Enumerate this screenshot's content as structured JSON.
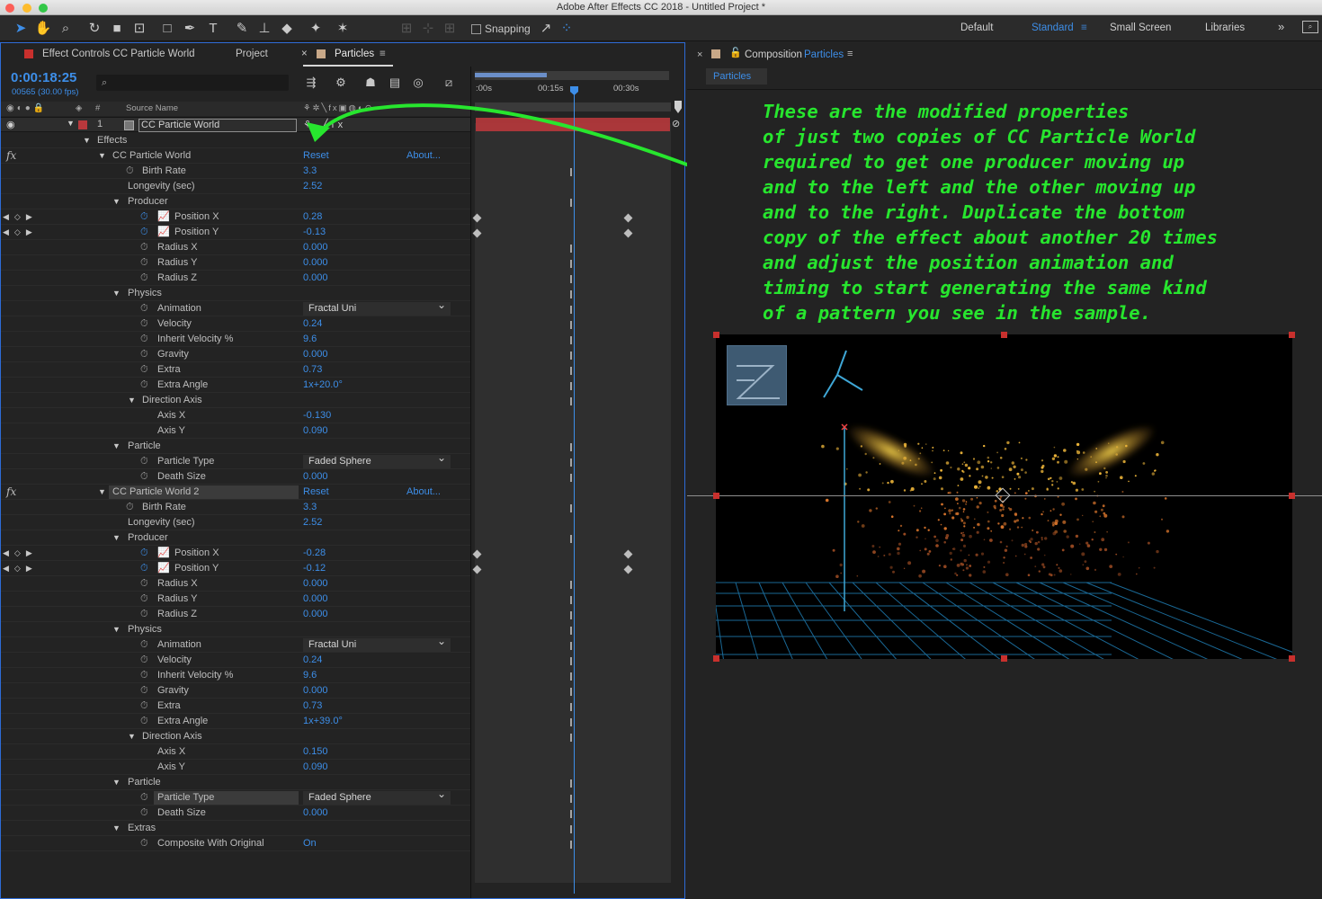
{
  "window": {
    "title": "Adobe After Effects CC 2018 - Untitled Project *"
  },
  "toolbar": {
    "snapping": "Snapping",
    "workspaces": [
      "Default",
      "Standard",
      "Small Screen",
      "Libraries"
    ],
    "active_workspace": "Standard",
    "more": "»"
  },
  "left_tabs": {
    "effect_controls": "Effect Controls CC Particle World",
    "project": "Project",
    "particles": "Particles",
    "close": "×",
    "menu": "≡"
  },
  "timecode": {
    "current": "0:00:18:25",
    "frames": "00565 (30.00 fps)",
    "search_icon": "⌕"
  },
  "columns": {
    "source_name": "Source Name",
    "hash": "#"
  },
  "layer": {
    "number": "1",
    "name": "CC Particle World"
  },
  "timeline": {
    "ticks": [
      ":00s",
      "00:15s",
      "00:30s"
    ]
  },
  "effects": {
    "effects_label": "Effects",
    "e1": {
      "name": "CC Particle World",
      "reset": "Reset",
      "about": "About...",
      "birth_rate": {
        "label": "Birth Rate",
        "value": "3.3"
      },
      "longevity": {
        "label": "Longevity (sec)",
        "value": "2.52"
      },
      "producer": "Producer",
      "pos_x": {
        "label": "Position X",
        "value": "0.28"
      },
      "pos_y": {
        "label": "Position Y",
        "value": "-0.13"
      },
      "rad_x": {
        "label": "Radius X",
        "value": "0.000"
      },
      "rad_y": {
        "label": "Radius Y",
        "value": "0.000"
      },
      "rad_z": {
        "label": "Radius Z",
        "value": "0.000"
      },
      "physics": "Physics",
      "animation": {
        "label": "Animation",
        "value": "Fractal Uni"
      },
      "velocity": {
        "label": "Velocity",
        "value": "0.24"
      },
      "inherit": {
        "label": "Inherit Velocity %",
        "value": "9.6"
      },
      "gravity": {
        "label": "Gravity",
        "value": "0.000"
      },
      "extra": {
        "label": "Extra",
        "value": "0.73"
      },
      "extra_angle": {
        "label": "Extra Angle",
        "value": "1x+20.0°"
      },
      "direction_axis": "Direction Axis",
      "axis_x": {
        "label": "Axis X",
        "value": "-0.130"
      },
      "axis_y": {
        "label": "Axis Y",
        "value": "0.090"
      },
      "particle": "Particle",
      "particle_type": {
        "label": "Particle Type",
        "value": "Faded Sphere"
      },
      "death_size": {
        "label": "Death Size",
        "value": "0.000"
      }
    },
    "e2": {
      "name": "CC Particle World 2",
      "reset": "Reset",
      "about": "About...",
      "birth_rate": {
        "label": "Birth Rate",
        "value": "3.3"
      },
      "longevity": {
        "label": "Longevity (sec)",
        "value": "2.52"
      },
      "producer": "Producer",
      "pos_x": {
        "label": "Position X",
        "value": "-0.28"
      },
      "pos_y": {
        "label": "Position Y",
        "value": "-0.12"
      },
      "rad_x": {
        "label": "Radius X",
        "value": "0.000"
      },
      "rad_y": {
        "label": "Radius Y",
        "value": "0.000"
      },
      "rad_z": {
        "label": "Radius Z",
        "value": "0.000"
      },
      "physics": "Physics",
      "animation": {
        "label": "Animation",
        "value": "Fractal Uni"
      },
      "velocity": {
        "label": "Velocity",
        "value": "0.24"
      },
      "inherit": {
        "label": "Inherit Velocity %",
        "value": "9.6"
      },
      "gravity": {
        "label": "Gravity",
        "value": "0.000"
      },
      "extra": {
        "label": "Extra",
        "value": "0.73"
      },
      "extra_angle": {
        "label": "Extra Angle",
        "value": "1x+39.0°"
      },
      "direction_axis": "Direction Axis",
      "axis_x": {
        "label": "Axis X",
        "value": "0.150"
      },
      "axis_y": {
        "label": "Axis Y",
        "value": "0.090"
      },
      "particle": "Particle",
      "particle_type": {
        "label": "Particle Type",
        "value": "Faded Sphere"
      },
      "death_size": {
        "label": "Death Size",
        "value": "0.000"
      },
      "extras": "Extras",
      "composite": {
        "label": "Composite With Original",
        "value": "On"
      }
    }
  },
  "composition": {
    "label": "Composition",
    "name": "Particles",
    "tab": "Particles",
    "close": "×",
    "menu": "≡"
  },
  "annotation": "These are the modified properties\nof just two copies of CC Particle World\nrequired to get one producer moving up\nand to the left and the other moving up\nand to the right. Duplicate the bottom\ncopy of the effect about another 20 times\nand adjust the position animation and\ntiming to start generating the same kind\nof a pattern you see in the sample.",
  "colors": {
    "accent": "#3d8ee8",
    "annotation": "#27e62e",
    "layer_bar": "#b8383c",
    "handle": "#c8302d"
  }
}
